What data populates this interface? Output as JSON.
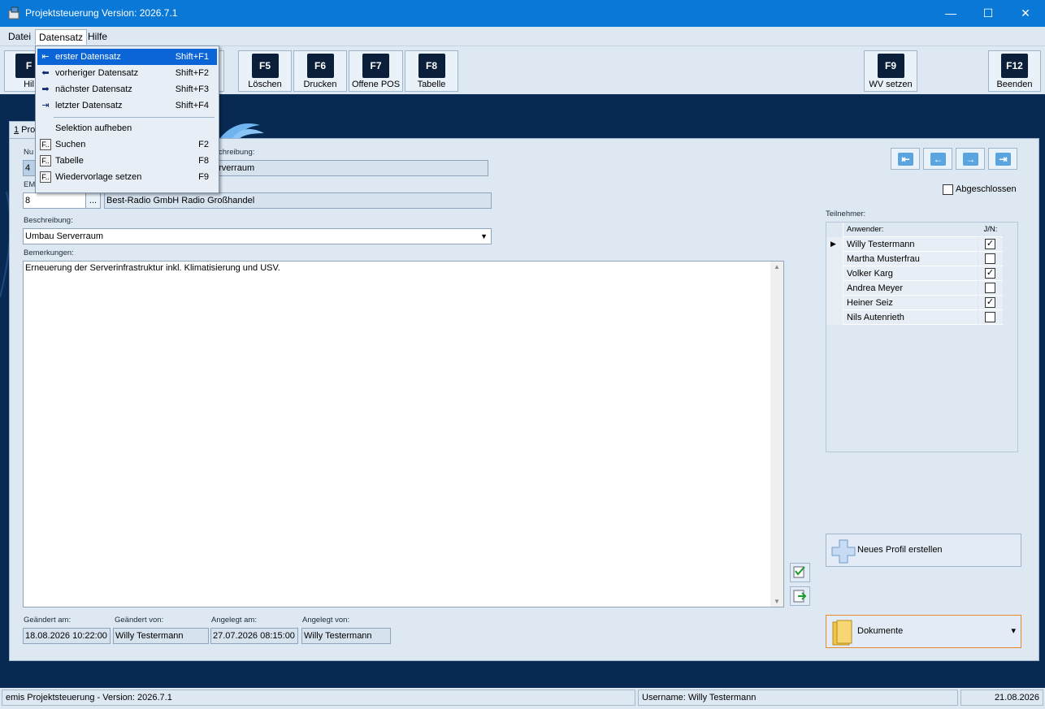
{
  "window": {
    "title": "Projektsteuerung Version: 2026.7.1",
    "min": "—",
    "max": "☐",
    "close": "✕"
  },
  "menubar": {
    "datei": "Datei",
    "datensatz": "Datensatz",
    "hilfe": "Hilfe"
  },
  "toolbar": {
    "f1": {
      "key": "F",
      "label": "Hil"
    },
    "f5": {
      "key": "F5",
      "label": "Löschen"
    },
    "f6": {
      "key": "F6",
      "label": "Drucken"
    },
    "f7": {
      "key": "F7",
      "label": "Offene POS"
    },
    "f8": {
      "key": "F8",
      "label": "Tabelle"
    },
    "f9": {
      "key": "F9",
      "label": "WV setzen"
    },
    "f12": {
      "key": "F12",
      "label": "Beenden"
    }
  },
  "tab": {
    "label_num": "1",
    "label_text": " Pro"
  },
  "form": {
    "nummer_label": "Nu",
    "nummer_value": "4",
    "kurzbeschreibung_label": "chreibung:",
    "kurzbeschreibung_value": "erverraum",
    "em_label": "EM",
    "em_value": "8",
    "em_button": "...",
    "company_value": "Best-Radio GmbH Radio Großhandel",
    "beschreibung_label": "Beschreibung:",
    "beschreibung_value": "Umbau Serverraum",
    "bemerkungen_label": "Bemerkungen:",
    "bemerkungen_value": "Erneuerung der Serverinfrastruktur inkl. Klimatisierung und USV.",
    "geaendert_am_label": "Geändert am:",
    "geaendert_am_value": "18.08.2026 10:22:00",
    "geaendert_von_label": "Geändert von:",
    "geaendert_von_value": "Willy Testermann",
    "angelegt_am_label": "Angelegt am:",
    "angelegt_am_value": "27.07.2026 08:15:00",
    "angelegt_von_label": "Angelegt von:",
    "angelegt_von_value": "Willy Testermann"
  },
  "nav": {
    "first": "⇤",
    "prev": "←",
    "next": "→",
    "last": "⇥"
  },
  "abgeschlossen": {
    "label": "Abgeschlossen",
    "checked": false
  },
  "teilnehmer": {
    "label": "Teilnehmer:",
    "col_anwender": "Anwender:",
    "col_jn": "J/N:",
    "rows": [
      {
        "name": "Willy Testermann",
        "checked": "✓",
        "current": "▶"
      },
      {
        "name": "Martha Musterfrau",
        "checked": "",
        "current": ""
      },
      {
        "name": "Volker Karg",
        "checked": "✓",
        "current": ""
      },
      {
        "name": "Andrea Meyer",
        "checked": "",
        "current": ""
      },
      {
        "name": "Heiner Seiz",
        "checked": "✓",
        "current": ""
      },
      {
        "name": "Nils Autenrieth",
        "checked": "",
        "current": ""
      }
    ]
  },
  "buttons": {
    "neues_profil": "Neues Profil erstellen",
    "dokumente": "Dokumente",
    "dokumente_arrow": "▾"
  },
  "dropdown": {
    "items": [
      {
        "label": "erster Datensatz",
        "shortcut": "Shift+F1",
        "icon": "first-record-icon",
        "glyph": "⇤"
      },
      {
        "label": "vorheriger Datensatz",
        "shortcut": "Shift+F2",
        "icon": "previous-record-icon",
        "glyph": "⬅"
      },
      {
        "label": "nächster Datensatz",
        "shortcut": "Shift+F3",
        "icon": "next-record-icon",
        "glyph": "➡"
      },
      {
        "label": "letzter Datensatz",
        "shortcut": "Shift+F4",
        "icon": "last-record-icon",
        "glyph": "⇥"
      },
      {
        "label": "Selektion aufheben",
        "shortcut": "",
        "icon": "",
        "glyph": ""
      },
      {
        "label": "Suchen",
        "shortcut": "F2",
        "icon": "function-key-icon",
        "glyph": "F.."
      },
      {
        "label": "Tabelle",
        "shortcut": "F8",
        "icon": "function-key-icon",
        "glyph": "F.."
      },
      {
        "label": "Wiedervorlage setzen",
        "shortcut": "F9",
        "icon": "function-key-icon",
        "glyph": "F.."
      }
    ]
  },
  "status": {
    "app": "emis Projektsteuerung - Version: 2026.7.1",
    "user": "Username: Willy Testermann",
    "date": "21.08.2026"
  },
  "colors": {
    "titlebar": "#0a78d7",
    "backdrop": "#082a52",
    "panel": "#dde8f3",
    "highlight": "#0b65d6",
    "accent": "#5aa5e0"
  }
}
